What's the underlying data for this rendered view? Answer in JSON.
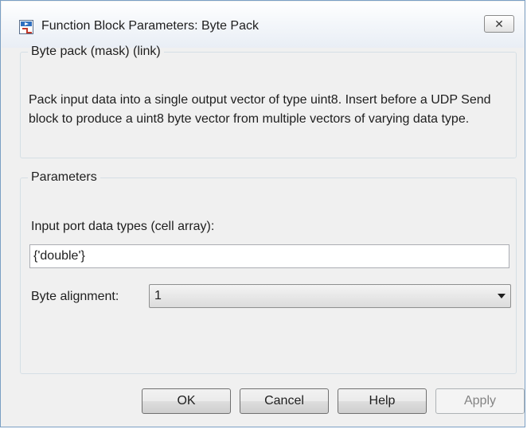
{
  "window": {
    "title": "Function Block Parameters: Byte Pack",
    "close_glyph": "✕"
  },
  "description": {
    "legend": "Byte pack (mask) (link)",
    "text": "Pack input data into a single output vector of type uint8. Insert before a UDP Send block to produce a uint8 byte vector from multiple vectors of varying data type."
  },
  "parameters": {
    "legend": "Parameters",
    "input_types_label": "Input port data types (cell array):",
    "input_types_value": "{'double'}",
    "alignment_label": "Byte alignment:",
    "alignment_value": "1"
  },
  "buttons": {
    "ok": "OK",
    "cancel": "Cancel",
    "help": "Help",
    "apply": "Apply"
  },
  "icons": {
    "app": "simulink-block-icon",
    "close": "close-icon",
    "dropdown": "chevron-down-icon"
  }
}
